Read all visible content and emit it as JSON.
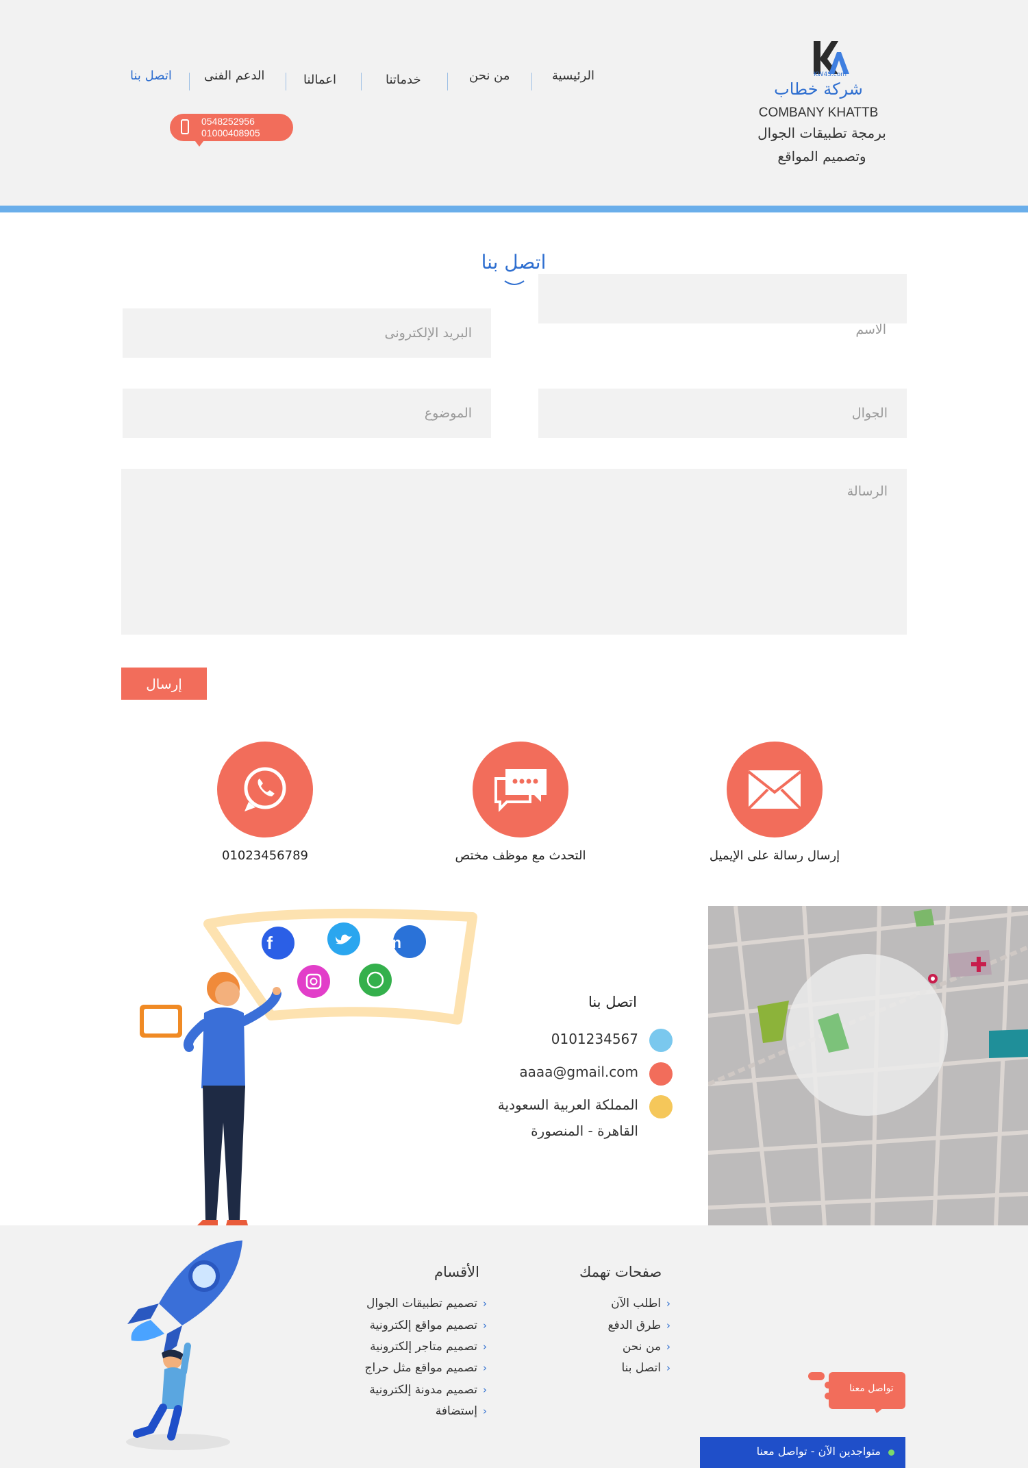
{
  "header": {
    "logo_text": "KW4S.com",
    "brand_ar": "شركة خطاب",
    "brand_en": "COMBANY KHATTB",
    "tagline_line1": "برمجة تطبيقات الجوال",
    "tagline_line2": "وتصميم المواقع",
    "nav": [
      "الرئيسية",
      "من نحن",
      "خدماتنا",
      "اعمالنا",
      "الدعم الفنى",
      "اتصل بنا"
    ],
    "active_nav": "اتصل بنا",
    "phones": [
      "0548252956",
      "01000408905"
    ]
  },
  "form": {
    "title": "اتصل بنا",
    "name_label": "الاسم",
    "email_placeholder": "البريد الإلكترونى",
    "mobile_placeholder": "الجوال",
    "subject_placeholder": "الموضوع",
    "message_placeholder": "الرسالة",
    "submit_label": "إرسال"
  },
  "contact_options": [
    {
      "label": "إرسال رسالة على الإيميل",
      "icon": "envelope-icon"
    },
    {
      "label": "التحدث مع موظف مختص",
      "icon": "chat-icon"
    },
    {
      "label": "01023456789",
      "icon": "whatsapp-icon"
    }
  ],
  "contact_info": {
    "title": "اتصل بنا",
    "phone": "0101234567",
    "email": "aaaa@gmail.com",
    "address_line1": "المملكة العربية السعودية",
    "address_line2": "القاهرة - المنصورة"
  },
  "footer": {
    "pages_title": "صفحات تهمك",
    "pages": [
      "اطلب الآن",
      "طرق الدفع",
      "من نحن",
      "اتصل بنا"
    ],
    "sections_title": "الأقسام",
    "sections": [
      "تصميم تطبيقات الجوال",
      "تصميم مواقع إلكترونية",
      "تصميم متاجر إلكترونية",
      "تصميم مواقع مثل حراج",
      "تصميم مدونة إلكترونية",
      "إستضافة"
    ],
    "contact_bubble": "تواصل معنا",
    "online_text": "متواجدين الآن - تواصل معنا"
  },
  "colors": {
    "accent": "#f26d5b",
    "brand_blue": "#2f6fd0",
    "header_bg": "#f2f2f2",
    "divider": "#6aaeea",
    "online_bar": "#1f4fc9"
  }
}
